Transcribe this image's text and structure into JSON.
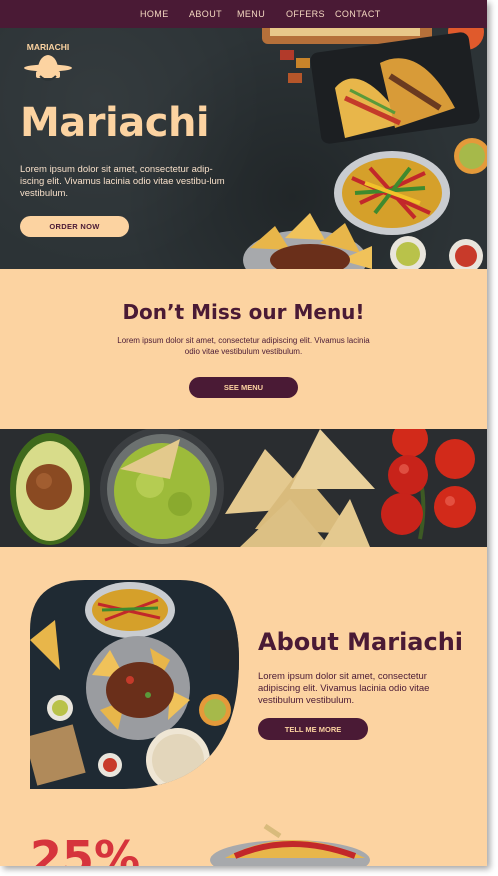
{
  "nav": {
    "items": [
      "HOME",
      "ABOUT",
      "MENU",
      "OFFERS",
      "CONTACT"
    ]
  },
  "hero": {
    "logo_text": "MARIACHI",
    "title": "Mariachi",
    "text": "Lorem ipsum dolor sit amet, consectetur adip-iscing elit. Vivamus lacinia odio vitae vestibu-lum vestibulum.",
    "order_button": "ORDER NOW"
  },
  "menu_section": {
    "title": "Don’t Miss our Menu!",
    "text": "Lorem ipsum dolor sit amet, consectetur adipiscing elit. Vivamus lacinia odio vitae vestibulum vestibulum.",
    "button": "SEE MENU"
  },
  "about": {
    "title": "About Mariachi",
    "text": "Lorem ipsum dolor sit amet, consectetur adipiscing elit. Vivamus lacinia odio vitae vestibulum vestibulum.",
    "button": "TELL ME MORE"
  },
  "promo": {
    "text": "25%"
  },
  "colors": {
    "brand_dark": "#4a1a35",
    "brand_light": "#fcd3a1",
    "accent_red": "#d6343c"
  }
}
